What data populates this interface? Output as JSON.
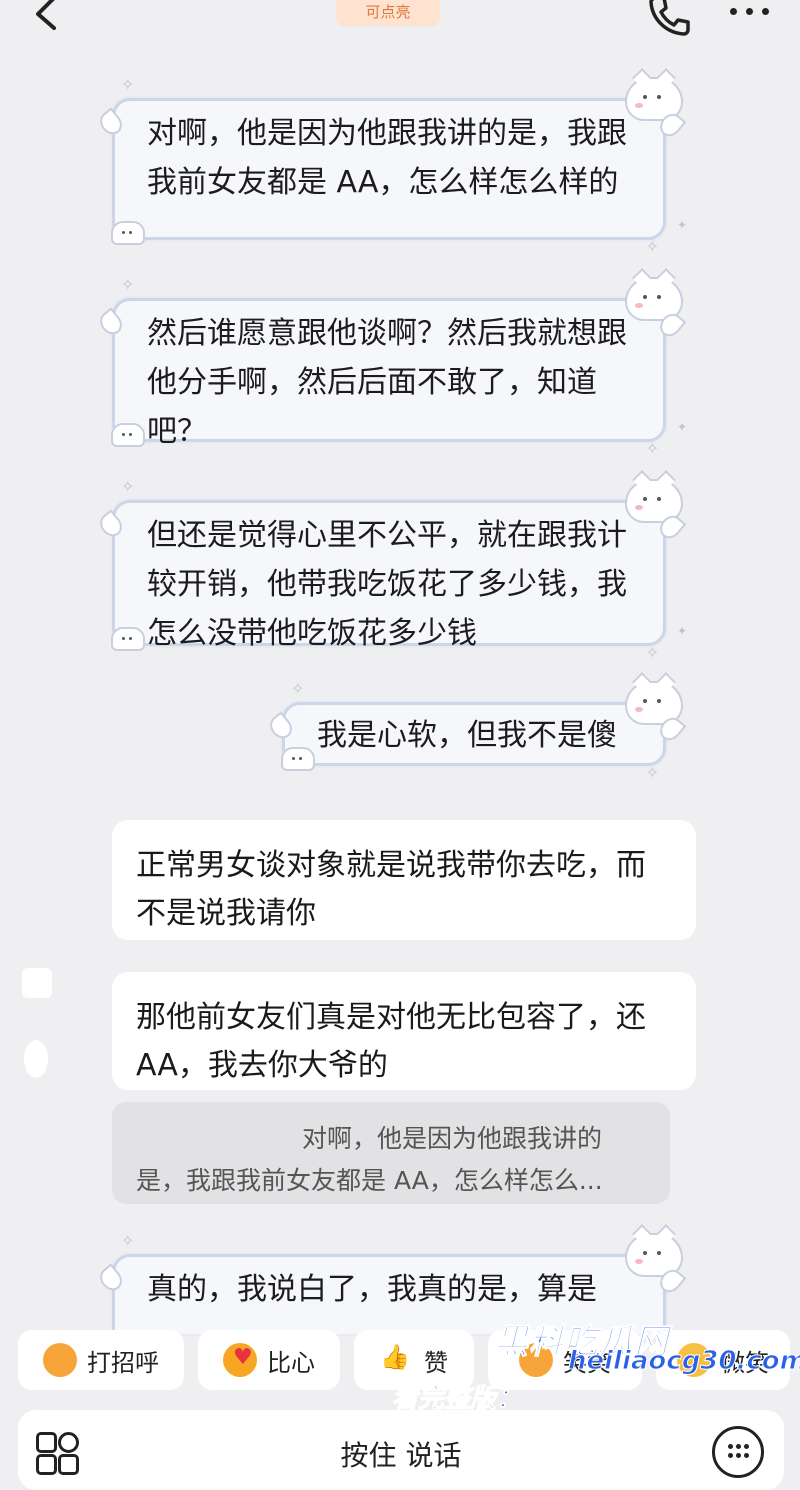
{
  "header": {
    "badge_text": "可点亮",
    "back_icon": "chevron-left-icon",
    "call_icon": "phone-icon",
    "more_icon": "more-dots-icon"
  },
  "messages": [
    {
      "style": "cute",
      "text": "对啊，他是因为他跟我讲的是，我跟我前女友都是 AA，怎么样怎么样的"
    },
    {
      "style": "cute",
      "text": "然后谁愿意跟他谈啊？然后我就想跟他分手啊，然后后面不敢了，知道吧？"
    },
    {
      "style": "cute",
      "text": "但还是觉得心里不公平，就在跟我计较开销，他带我吃饭花了多少钱，我怎么没带他吃饭花多少钱"
    },
    {
      "style": "cute",
      "text": "我是心软，但我不是傻"
    },
    {
      "style": "plain",
      "text": "正常男女谈对象就是说我带你去吃，而不是说我请你"
    },
    {
      "style": "plain",
      "text": "那他前女友们真是对他无比包容了，还 AA，我去你大爷的"
    },
    {
      "style": "quote",
      "line1": "对啊，他是因为他跟我讲的",
      "line2": "是，我跟我前女友都是 AA，怎么样怎么..."
    },
    {
      "style": "cute",
      "text": "真的，我说白了，我真的是，算是"
    }
  ],
  "quick_replies": [
    {
      "label": "打招呼",
      "icon": "smile-emoji-icon"
    },
    {
      "label": "比心",
      "icon": "heart-hand-emoji-icon"
    },
    {
      "label": "赞",
      "icon": "thumbs-up-icon"
    },
    {
      "label": "笑笑",
      "icon": "laugh-emoji-icon"
    },
    {
      "label": "微笑",
      "icon": "smirk-emoji-icon"
    }
  ],
  "watermark": {
    "line1": "黑料吃瓜网",
    "line2": "heiliaocg30.com",
    "line3": "看完整版：https://heiliaocg30.com"
  },
  "input_bar": {
    "voice_label": "按住 说话",
    "apps_icon": "apps-grid-icon",
    "keyboard_icon": "keyboard-icon"
  },
  "colors": {
    "background": "#efeff1",
    "badge_bg": "#fde3d0",
    "badge_text": "#e2793e",
    "bubble_border": "#cdd5e6",
    "watermark": "#2a61e8"
  }
}
